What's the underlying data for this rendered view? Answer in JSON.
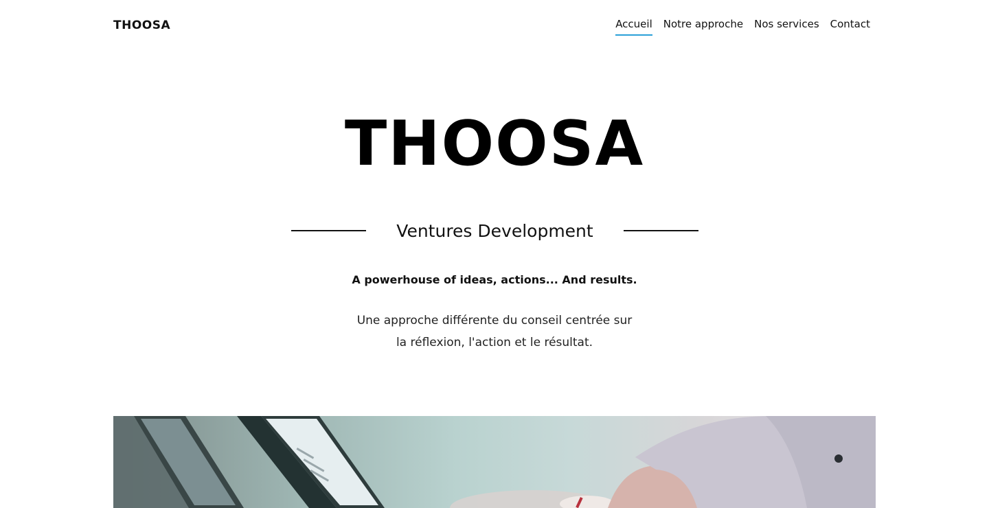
{
  "header": {
    "brand": "THOOSA",
    "nav": [
      {
        "label": "Accueil",
        "active": true
      },
      {
        "label": "Notre approche",
        "active": false
      },
      {
        "label": "Nos services",
        "active": false
      },
      {
        "label": "Contact",
        "active": false
      }
    ]
  },
  "hero": {
    "title": "THOOSA",
    "subtitle": "Ventures Development",
    "tagline": "A powerhouse of ideas, actions... And results.",
    "description_line1": "Une approche différente du conseil centrée sur",
    "description_line2": "la réflexion, l'action et le résultat."
  },
  "colors": {
    "accent": "#2aa0d8",
    "text": "#111111",
    "background": "#ffffff"
  }
}
